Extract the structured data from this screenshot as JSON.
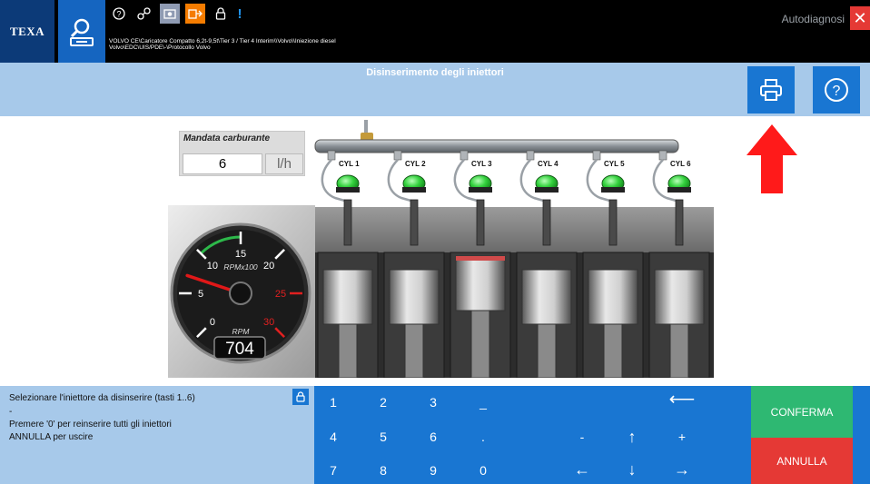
{
  "topbar": {
    "logo_text": "TEXA",
    "vehicle_path_line1": "VOLVO CE\\Caricatore Compatto 6,2t-9,5t\\Tier 3 / Tier 4 Interim\\\\Volvo\\\\Iniezione diesel",
    "vehicle_path_line2": "Volvo\\EDC\\UIS/PDE\\-\\Protocollo Volvo",
    "mode_label": "Autodiagnosi",
    "icons": [
      "help-icon",
      "connection-icon",
      "camera-icon",
      "export-icon",
      "lock-icon",
      "alert-icon"
    ]
  },
  "header": {
    "title": "Disinserimento degli iniettori",
    "print_icon": "printer-icon",
    "help_icon": "help-circle-icon"
  },
  "fuel": {
    "label": "Mandata carburante",
    "value": "6",
    "unit": "l/h"
  },
  "gauge": {
    "rpm_value": "704",
    "scale_label": "RPMx100",
    "rpm_label": "RPM",
    "ticks": [
      "0",
      "5",
      "10",
      "15",
      "20",
      "25",
      "30"
    ],
    "needle_value": 7.04
  },
  "cylinders": [
    "CYL 1",
    "CYL 2",
    "CYL 3",
    "CYL 4",
    "CYL 5",
    "CYL 6"
  ],
  "message": {
    "line1": "Selezionare l'iniettore da disinserire (tasti 1..6)",
    "line2": "-",
    "line3": "Premere '0' per reinserire tutti gli iniettori",
    "line4": "ANNULLA per uscire"
  },
  "keypad": {
    "row1": [
      "1",
      "2",
      "3",
      "_"
    ],
    "row2": [
      "4",
      "5",
      "6",
      "."
    ],
    "row3": [
      "7",
      "8",
      "9",
      "0"
    ],
    "backspace": "⟵",
    "minus": "-",
    "up": "↑",
    "plus": "+",
    "left": "←",
    "down": "↓",
    "right": "→"
  },
  "actions": {
    "confirm": "CONFERMA",
    "cancel": "ANNULLA"
  },
  "colors": {
    "accent_blue": "#1976d2",
    "header_light_blue": "#a7c9ea",
    "confirm_green": "#2eb872",
    "cancel_red": "#e53935",
    "tool_orange": "#f57c00",
    "injector_green": "#33d13d"
  }
}
